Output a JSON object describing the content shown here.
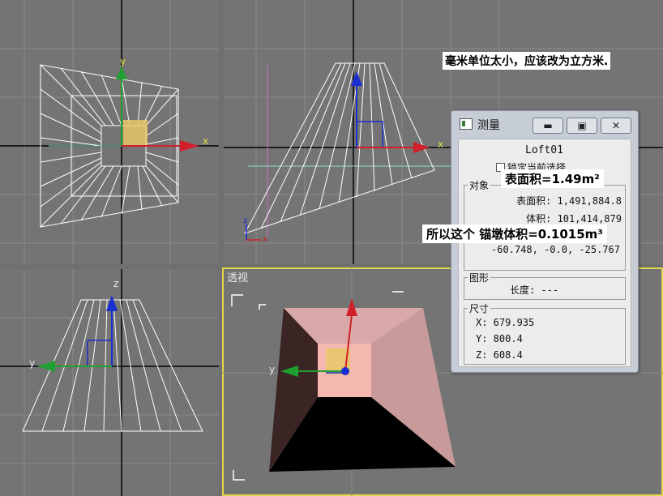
{
  "viewports": {
    "top": {
      "axis_x": "x",
      "axis_y": "y"
    },
    "front": {
      "axis_x": "x",
      "axis_z": "z"
    },
    "left": {
      "axis_y": "y",
      "axis_z": "z"
    },
    "perspective": {
      "label": "透视",
      "axis_y": "y"
    }
  },
  "annotations": {
    "unit_note": "毫米单位太小，应该改为立方米.",
    "surface_area": "表面积=1.49m²",
    "volume": "所以这个 锚墩体积=0.1015m³"
  },
  "measure_dialog": {
    "title": "测量",
    "controls": {
      "minimize": "▬",
      "maximize": "▣",
      "close": "✕"
    },
    "object_name": "Loft01",
    "lock_selection_label": "锁定当前选择",
    "objects_group": {
      "label": "对象",
      "surface_area": "表面积: 1,491,884.8",
      "volume": "体积: 101,414,879",
      "center": "-60.748, -0.0, -25.767"
    },
    "shapes_group": {
      "label": "图形",
      "length": "长度: ---"
    },
    "dimensions_group": {
      "label": "尺寸",
      "x": "X:  679.935",
      "y": "Y:  800.4",
      "z": "Z:  608.4"
    }
  },
  "colors": {
    "viewport_bg": "#747474",
    "grid_line": "#8a8a8a",
    "axis_line": "#1e1e1e",
    "wireframe": "#ffffff",
    "gizmo_x": "#d0202a",
    "gizmo_y": "#20a030",
    "gizmo_z": "#1a2fd0",
    "active_border": "#e3d74a",
    "selection_yellow": "#e8c86a",
    "face_light": "#d9a8a8",
    "face_dark": "#3a2424",
    "face_side": "#b98a8a",
    "face_inner": "#f5b8b0"
  }
}
